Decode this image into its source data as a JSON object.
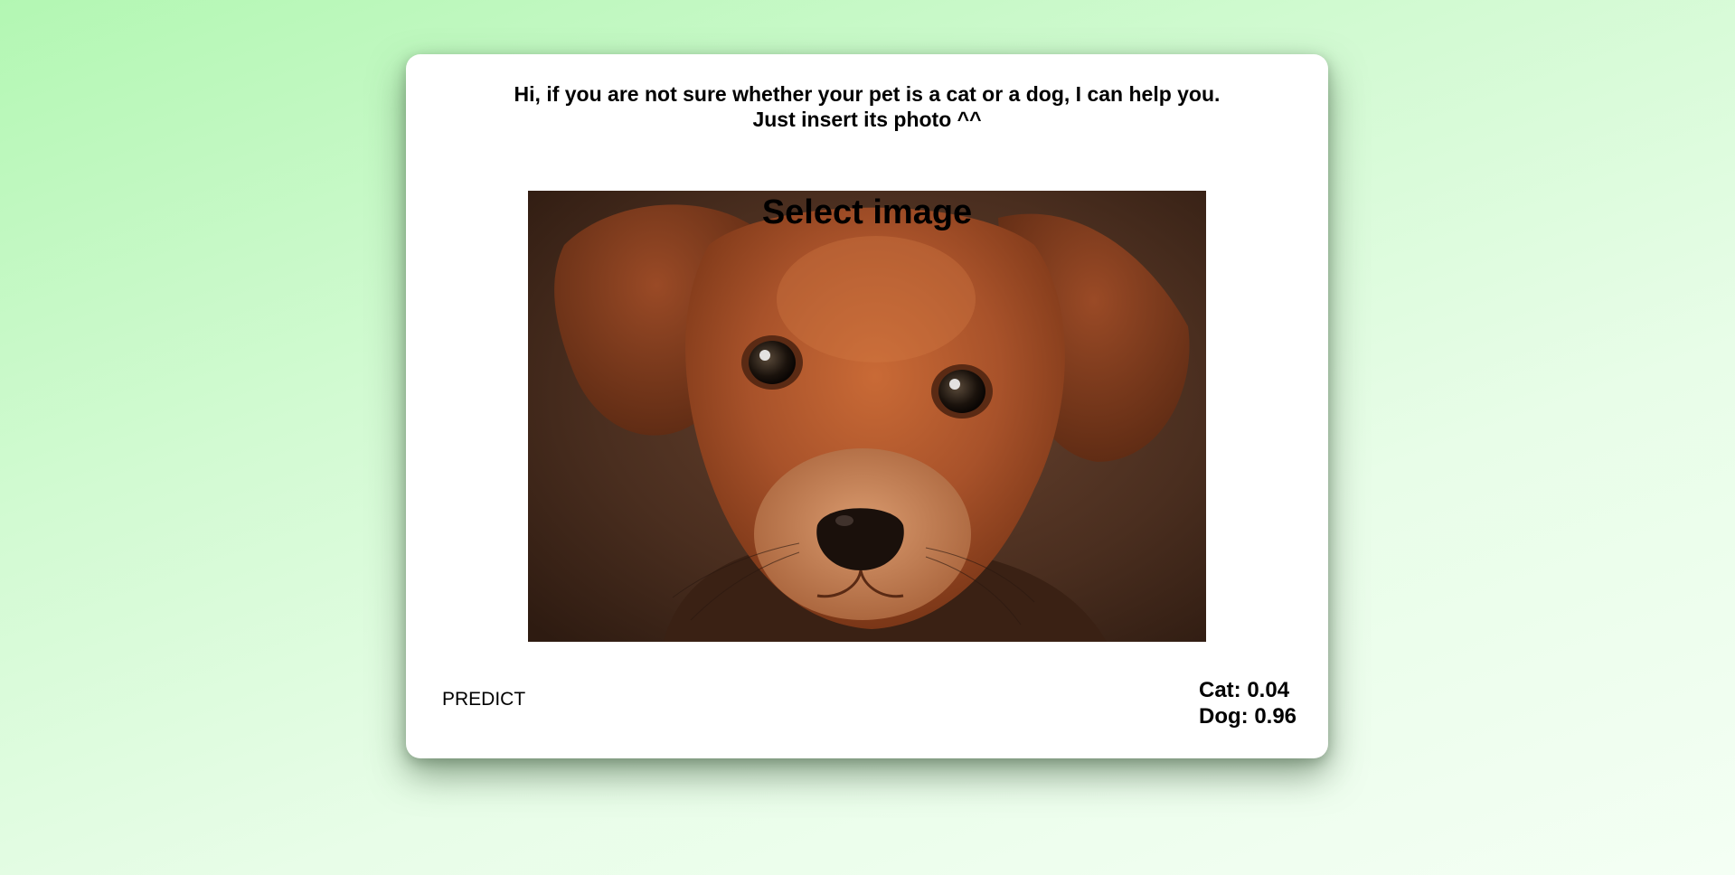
{
  "intro": {
    "line1": "Hi, if you are not sure whether your pet is a cat or a dog, I can help you.",
    "line2": "Just insert its photo ^^"
  },
  "uploader": {
    "label": "Select image",
    "image_subject": "brown puppy photo"
  },
  "actions": {
    "predict_label": "PREDICT"
  },
  "results": {
    "cat": "Cat: 0.04",
    "dog": "Dog: 0.96"
  },
  "colors": {
    "background_start": "#b3f7b3",
    "background_end": "#f4fff4",
    "card": "#ffffff",
    "text": "#000000",
    "fur": "#a8522a",
    "photo_background": "#3f2618"
  }
}
